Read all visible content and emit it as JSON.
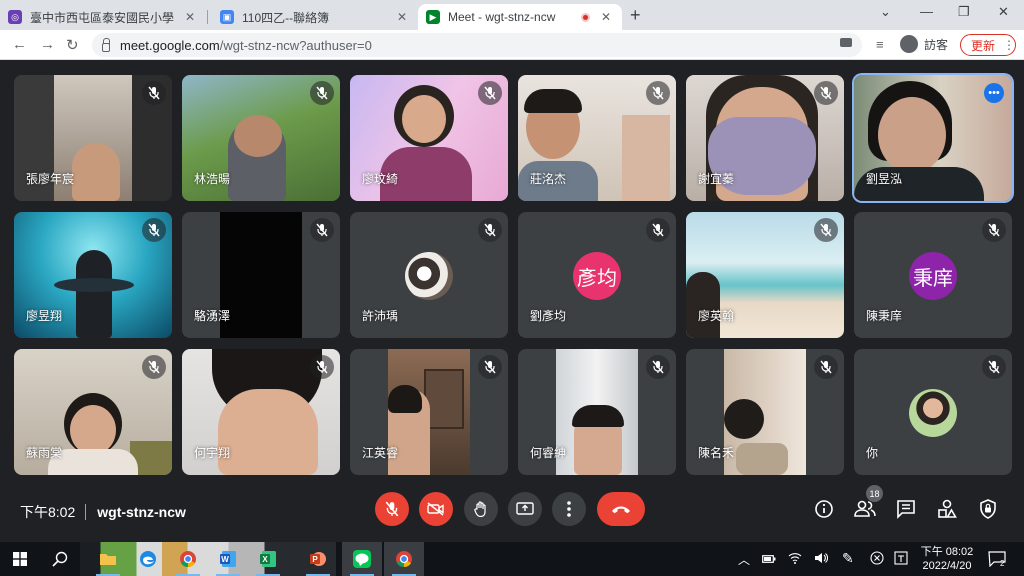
{
  "browser": {
    "tabs": [
      {
        "title": "臺中市西屯區泰安國民小學",
        "active": false
      },
      {
        "title": "110四乙--聯絡簿",
        "active": false
      },
      {
        "title": "Meet - wgt-stnz-ncw",
        "active": true
      }
    ],
    "url_host": "meet.google.com",
    "url_path": "/wgt-stnz-ncw?authuser=0",
    "guest_label": "訪客",
    "update_label": "更新"
  },
  "participants": [
    {
      "name": "張廖年宸",
      "muted": true
    },
    {
      "name": "林浩暘",
      "muted": true
    },
    {
      "name": "廖玟綺",
      "muted": true
    },
    {
      "name": "莊洺杰",
      "muted": true
    },
    {
      "name": "謝宜蓁",
      "muted": true
    },
    {
      "name": "劉昱泓",
      "muted": false,
      "speaking": true
    },
    {
      "name": "廖昱翔",
      "muted": true
    },
    {
      "name": "駱湧澤",
      "muted": true
    },
    {
      "name": "許沛瑀",
      "muted": true
    },
    {
      "name": "劉彥均",
      "muted": true,
      "avatar_text": "彥均",
      "avatar_color": "#e8336e"
    },
    {
      "name": "廖英翰",
      "muted": true
    },
    {
      "name": "陳秉庠",
      "muted": true,
      "avatar_text": "秉庠",
      "avatar_color": "#8e24aa"
    },
    {
      "name": "蘇雨棠",
      "muted": true
    },
    {
      "name": "何宇翔",
      "muted": true
    },
    {
      "name": "江英睿",
      "muted": true
    },
    {
      "name": "何睿紳",
      "muted": true
    },
    {
      "name": "陳名禾",
      "muted": true
    },
    {
      "name": "你",
      "muted": true
    }
  ],
  "meeting": {
    "time": "下午8:02",
    "code": "wgt-stnz-ncw",
    "participant_count": "18"
  },
  "controls": [
    "microphone-off-icon",
    "camera-off-icon",
    "raise-hand-icon",
    "present-icon",
    "more-options-icon",
    "hang-up-icon"
  ],
  "right_controls": [
    "info-icon",
    "people-icon",
    "chat-icon",
    "activities-icon",
    "host-controls-icon"
  ],
  "taskbar": {
    "clock_time": "下午 08:02",
    "clock_date": "2022/4/20",
    "notification_count": "2"
  },
  "colors": {
    "meet_bg": "#202124",
    "tile_bg": "#3c4043",
    "danger": "#ea4335",
    "accent": "#1a73e8"
  }
}
